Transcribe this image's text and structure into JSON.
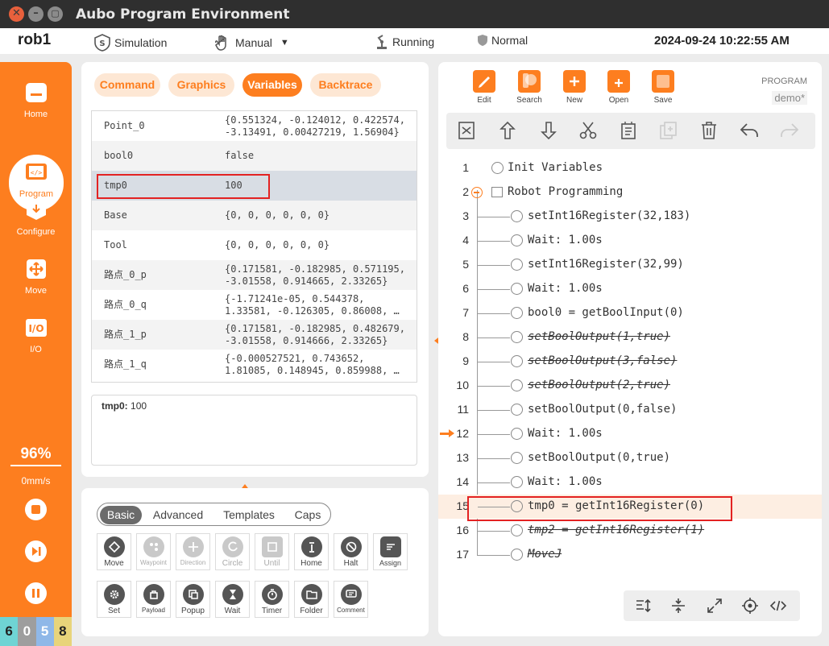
{
  "window": {
    "title": "Aubo Program Environment",
    "close": "✕",
    "minimize": "–",
    "maximize": "▢"
  },
  "status": {
    "robot": "rob1",
    "mode": "Simulation",
    "control": "Manual",
    "state": "Running",
    "safety": "Normal",
    "datetime": "2024-09-24 10:22:55 AM"
  },
  "sidebar": {
    "items": [
      {
        "label": "Home"
      },
      {
        "label": "Program"
      },
      {
        "label": "Configure"
      },
      {
        "label": "Move"
      },
      {
        "label": "I/O"
      }
    ],
    "speed": "96%",
    "velocity": "0mm/s",
    "version": [
      "6",
      "0",
      "5",
      "8"
    ],
    "colors": {
      "accent": "#fd7e1f"
    }
  },
  "var_tabs": [
    "Command",
    "Graphics",
    "Variables",
    "Backtrace"
  ],
  "variables": [
    {
      "name": "Point_0",
      "value": "{0.551324, -0.124012, 0.422574,\n-3.13491, 0.00427219, 1.56904}"
    },
    {
      "name": "bool0",
      "value": "false"
    },
    {
      "name": "tmp0",
      "value": "100"
    },
    {
      "name": "Base",
      "value": "{0, 0, 0, 0, 0, 0}"
    },
    {
      "name": "Tool",
      "value": "{0, 0, 0, 0, 0, 0}"
    },
    {
      "name": "路点_0_p",
      "value": "{0.171581, -0.182985, 0.571195,\n-3.01558, 0.914665, 2.33265}"
    },
    {
      "name": "路点_0_q",
      "value": "{-1.71241e-05, 0.544378,\n1.33581, -0.126305, 0.86008, …"
    },
    {
      "name": "路点_1_p",
      "value": "{0.171581, -0.182985, 0.482679,\n-3.01558, 0.914666, 2.33265}"
    },
    {
      "name": "路点_1_q",
      "value": "{-0.000527521, 0.743652,\n1.81085, 0.148945, 0.859988, …"
    }
  ],
  "detail": {
    "name": "tmp0:",
    "value": "100"
  },
  "cmd_tabs": [
    "Basic",
    "Advanced",
    "Templates",
    "Caps"
  ],
  "commands": [
    {
      "label": "Move"
    },
    {
      "label": "Waypoint"
    },
    {
      "label": "Direction"
    },
    {
      "label": "Circle"
    },
    {
      "label": "Until"
    },
    {
      "label": "Home"
    },
    {
      "label": "Halt"
    },
    {
      "label": "Assign"
    },
    {
      "label": "Set"
    },
    {
      "label": "Payload"
    },
    {
      "label": "Popup"
    },
    {
      "label": "Wait"
    },
    {
      "label": "Timer"
    },
    {
      "label": "Folder"
    },
    {
      "label": "Comment"
    }
  ],
  "toolbar": [
    "Edit",
    "Search",
    "New",
    "Open",
    "Save"
  ],
  "program": {
    "label": "PROGRAM",
    "name": "demo*"
  },
  "lines": [
    {
      "n": "1",
      "text": "Init Variables"
    },
    {
      "n": "2",
      "text": "Robot Programming"
    },
    {
      "n": "3",
      "text": "setInt16Register(32,183)"
    },
    {
      "n": "4",
      "text": "Wait: 1.00s"
    },
    {
      "n": "5",
      "text": "setInt16Register(32,99)"
    },
    {
      "n": "6",
      "text": "Wait: 1.00s"
    },
    {
      "n": "7",
      "text": "bool0 = getBoolInput(0)"
    },
    {
      "n": "8",
      "text": "setBoolOutput(1,true)"
    },
    {
      "n": "9",
      "text": "setBoolOutput(3,false)"
    },
    {
      "n": "10",
      "text": "setBoolOutput(2,true)"
    },
    {
      "n": "11",
      "text": "setBoolOutput(0,false)"
    },
    {
      "n": "12",
      "text": "Wait: 1.00s"
    },
    {
      "n": "13",
      "text": "setBoolOutput(0,true)"
    },
    {
      "n": "14",
      "text": "Wait: 1.00s"
    },
    {
      "n": "15",
      "text": "tmp0 = getInt16Register(0)"
    },
    {
      "n": "16",
      "text": "tmp2 = getInt16Register(1)"
    },
    {
      "n": "17",
      "text": "MoveJ"
    }
  ]
}
